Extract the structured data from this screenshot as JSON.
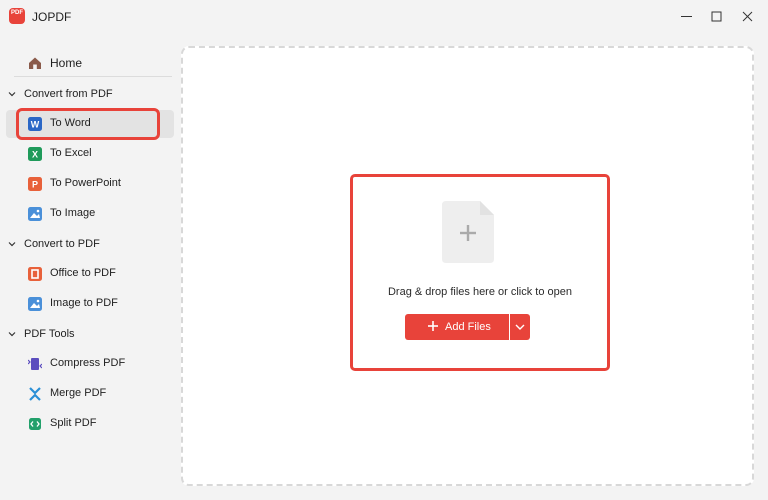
{
  "window": {
    "title": "JOPDF",
    "logo_text": "PDF",
    "controls": [
      "minimize",
      "maximize",
      "close"
    ]
  },
  "sidebar": {
    "home": {
      "label": "Home",
      "icon": "home-icon"
    },
    "groups": [
      {
        "label": "Convert from PDF",
        "items": [
          {
            "label": "To Word",
            "icon": "word-icon",
            "active": true
          },
          {
            "label": "To Excel",
            "icon": "excel-icon"
          },
          {
            "label": "To PowerPoint",
            "icon": "powerpoint-icon"
          },
          {
            "label": "To Image",
            "icon": "image-icon"
          }
        ]
      },
      {
        "label": "Convert to PDF",
        "items": [
          {
            "label": "Office to PDF",
            "icon": "office-icon"
          },
          {
            "label": "Image to PDF",
            "icon": "image-icon"
          }
        ]
      },
      {
        "label": "PDF Tools",
        "items": [
          {
            "label": "Compress PDF",
            "icon": "compress-icon"
          },
          {
            "label": "Merge PDF",
            "icon": "merge-icon"
          },
          {
            "label": "Split PDF",
            "icon": "split-icon"
          }
        ]
      }
    ]
  },
  "main": {
    "drop_text": "Drag & drop files here or click to open",
    "add_button_label": "Add Files"
  },
  "colors": {
    "accent": "#e8433a",
    "word": "#2b67c6",
    "excel": "#1f9a5a",
    "powerpoint": "#e8613a",
    "image": "#4a90d9",
    "office": "#e8613a",
    "compress": "#5b4dbe",
    "merge": "#2a8fd6",
    "split": "#22a06b"
  }
}
